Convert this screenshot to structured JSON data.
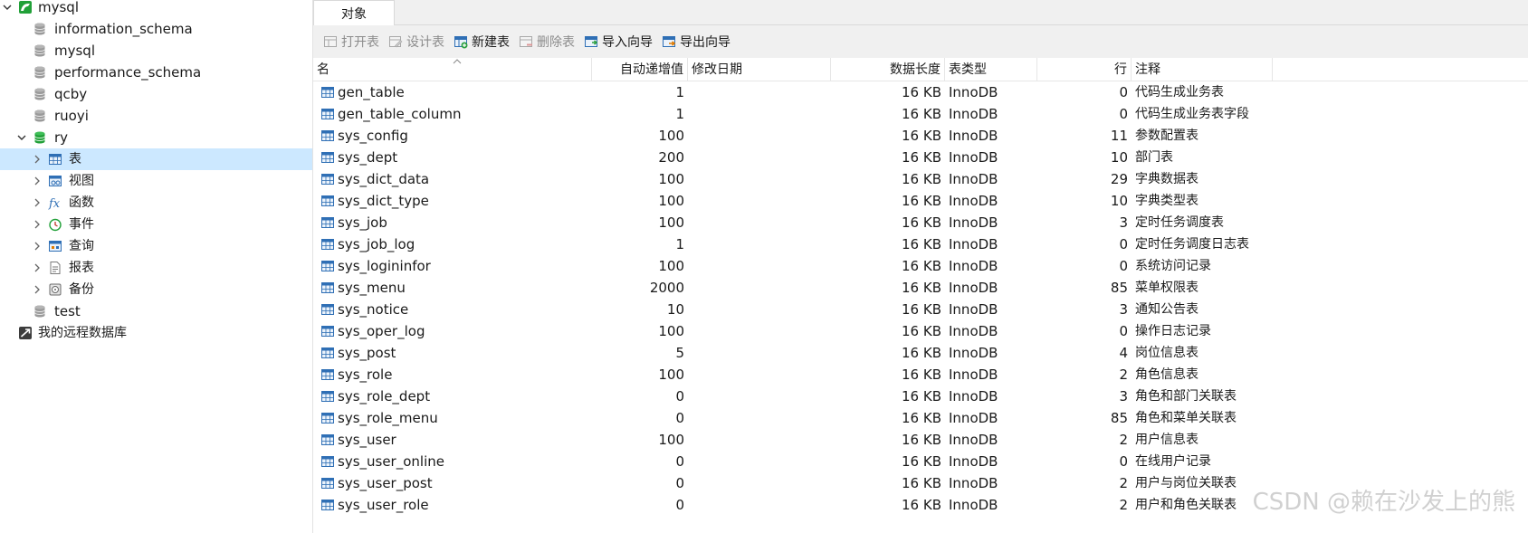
{
  "tree": {
    "connection": {
      "label": "mysql",
      "icon": "mysql-connection-icon"
    },
    "databases_before": [
      {
        "label": "information_schema",
        "icon": "database-icon"
      },
      {
        "label": "mysql",
        "icon": "database-icon"
      },
      {
        "label": "performance_schema",
        "icon": "database-icon"
      },
      {
        "label": "qcby",
        "icon": "database-icon"
      },
      {
        "label": "ruoyi",
        "icon": "database-icon"
      }
    ],
    "open_database": {
      "label": "ry",
      "icon": "database-open-icon"
    },
    "object_types": [
      {
        "key": "tables",
        "label": "表",
        "icon": "table-icon"
      },
      {
        "key": "views",
        "label": "视图",
        "icon": "view-icon"
      },
      {
        "key": "functions",
        "label": "函数",
        "icon": "function-icon"
      },
      {
        "key": "events",
        "label": "事件",
        "icon": "event-icon"
      },
      {
        "key": "queries",
        "label": "查询",
        "icon": "query-icon"
      },
      {
        "key": "reports",
        "label": "报表",
        "icon": "report-icon"
      },
      {
        "key": "backups",
        "label": "备份",
        "icon": "backup-icon"
      }
    ],
    "selected_object_type": "tables",
    "databases_after": [
      {
        "label": "test",
        "icon": "database-icon"
      }
    ],
    "remote": {
      "label": "我的远程数据库",
      "icon": "remote-db-icon"
    }
  },
  "tabs": {
    "objects": "对象"
  },
  "toolbar": {
    "open_table": "打开表",
    "design_table": "设计表",
    "new_table": "新建表",
    "delete_table": "删除表",
    "import_wizard": "导入向导",
    "export_wizard": "导出向导"
  },
  "columns": {
    "name": "名",
    "auto_increment": "自动递增值",
    "modified": "修改日期",
    "data_length": "数据长度",
    "engine": "表类型",
    "rows": "行",
    "comment": "注释"
  },
  "tables": [
    {
      "name": "gen_table",
      "auto_increment": "1",
      "modified": "",
      "data_length": "16 KB",
      "engine": "InnoDB",
      "rows": "0",
      "comment": "代码生成业务表"
    },
    {
      "name": "gen_table_column",
      "auto_increment": "1",
      "modified": "",
      "data_length": "16 KB",
      "engine": "InnoDB",
      "rows": "0",
      "comment": "代码生成业务表字段"
    },
    {
      "name": "sys_config",
      "auto_increment": "100",
      "modified": "",
      "data_length": "16 KB",
      "engine": "InnoDB",
      "rows": "11",
      "comment": "参数配置表"
    },
    {
      "name": "sys_dept",
      "auto_increment": "200",
      "modified": "",
      "data_length": "16 KB",
      "engine": "InnoDB",
      "rows": "10",
      "comment": "部门表"
    },
    {
      "name": "sys_dict_data",
      "auto_increment": "100",
      "modified": "",
      "data_length": "16 KB",
      "engine": "InnoDB",
      "rows": "29",
      "comment": "字典数据表"
    },
    {
      "name": "sys_dict_type",
      "auto_increment": "100",
      "modified": "",
      "data_length": "16 KB",
      "engine": "InnoDB",
      "rows": "10",
      "comment": "字典类型表"
    },
    {
      "name": "sys_job",
      "auto_increment": "100",
      "modified": "",
      "data_length": "16 KB",
      "engine": "InnoDB",
      "rows": "3",
      "comment": "定时任务调度表"
    },
    {
      "name": "sys_job_log",
      "auto_increment": "1",
      "modified": "",
      "data_length": "16 KB",
      "engine": "InnoDB",
      "rows": "0",
      "comment": "定时任务调度日志表"
    },
    {
      "name": "sys_logininfor",
      "auto_increment": "100",
      "modified": "",
      "data_length": "16 KB",
      "engine": "InnoDB",
      "rows": "0",
      "comment": "系统访问记录"
    },
    {
      "name": "sys_menu",
      "auto_increment": "2000",
      "modified": "",
      "data_length": "16 KB",
      "engine": "InnoDB",
      "rows": "85",
      "comment": "菜单权限表"
    },
    {
      "name": "sys_notice",
      "auto_increment": "10",
      "modified": "",
      "data_length": "16 KB",
      "engine": "InnoDB",
      "rows": "3",
      "comment": "通知公告表"
    },
    {
      "name": "sys_oper_log",
      "auto_increment": "100",
      "modified": "",
      "data_length": "16 KB",
      "engine": "InnoDB",
      "rows": "0",
      "comment": "操作日志记录"
    },
    {
      "name": "sys_post",
      "auto_increment": "5",
      "modified": "",
      "data_length": "16 KB",
      "engine": "InnoDB",
      "rows": "4",
      "comment": "岗位信息表"
    },
    {
      "name": "sys_role",
      "auto_increment": "100",
      "modified": "",
      "data_length": "16 KB",
      "engine": "InnoDB",
      "rows": "2",
      "comment": "角色信息表"
    },
    {
      "name": "sys_role_dept",
      "auto_increment": "0",
      "modified": "",
      "data_length": "16 KB",
      "engine": "InnoDB",
      "rows": "3",
      "comment": "角色和部门关联表"
    },
    {
      "name": "sys_role_menu",
      "auto_increment": "0",
      "modified": "",
      "data_length": "16 KB",
      "engine": "InnoDB",
      "rows": "85",
      "comment": "角色和菜单关联表"
    },
    {
      "name": "sys_user",
      "auto_increment": "100",
      "modified": "",
      "data_length": "16 KB",
      "engine": "InnoDB",
      "rows": "2",
      "comment": "用户信息表"
    },
    {
      "name": "sys_user_online",
      "auto_increment": "0",
      "modified": "",
      "data_length": "16 KB",
      "engine": "InnoDB",
      "rows": "0",
      "comment": "在线用户记录"
    },
    {
      "name": "sys_user_post",
      "auto_increment": "0",
      "modified": "",
      "data_length": "16 KB",
      "engine": "InnoDB",
      "rows": "2",
      "comment": "用户与岗位关联表"
    },
    {
      "name": "sys_user_role",
      "auto_increment": "0",
      "modified": "",
      "data_length": "16 KB",
      "engine": "InnoDB",
      "rows": "2",
      "comment": "用户和角色关联表"
    }
  ],
  "watermark": "CSDN @赖在沙发上的熊",
  "colors": {
    "selection": "#cce8ff",
    "mysql_green": "#21a038",
    "table_icon_blue": "#2f6fb5",
    "disabled_text": "#8c8c8c"
  }
}
